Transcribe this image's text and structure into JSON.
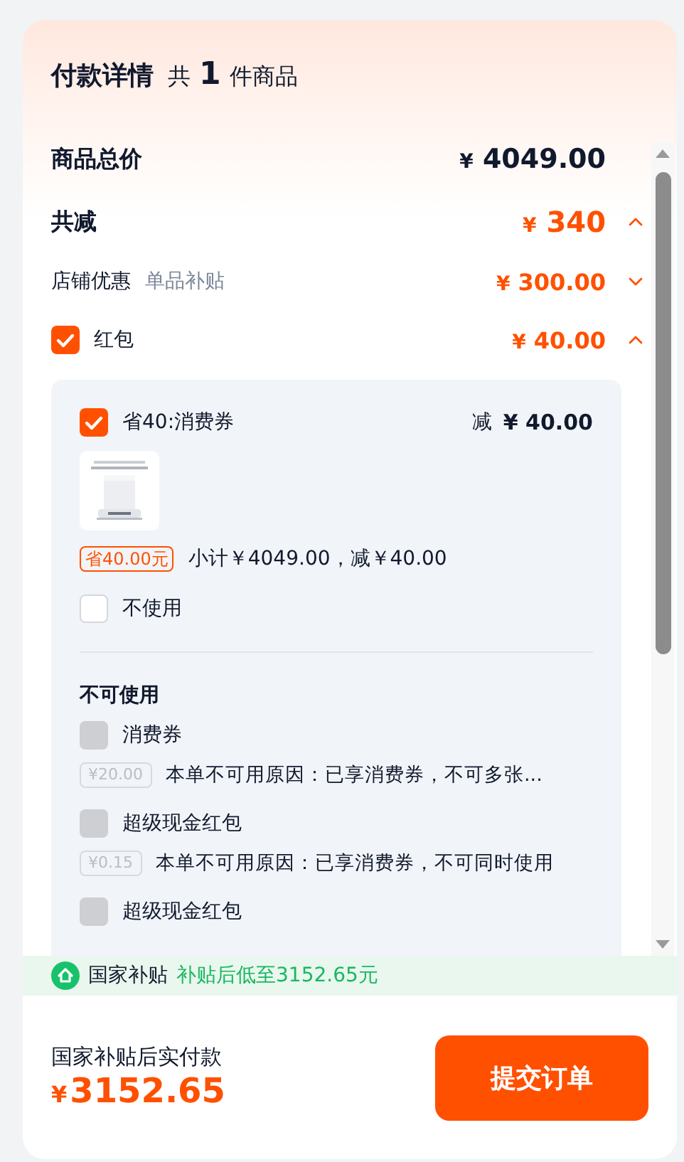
{
  "header": {
    "title": "付款详情",
    "count_prefix": "共",
    "count": "1",
    "count_suffix": "件商品"
  },
  "summary": [
    {
      "kind": "total",
      "label": "商品总价",
      "currency": "¥",
      "amount": "4049.00"
    },
    {
      "kind": "discount_total",
      "label": "共减",
      "currency": "¥",
      "amount": "340",
      "expanded": true
    },
    {
      "kind": "shop",
      "label": "店铺优惠",
      "tag": "单品补贴",
      "currency": "¥",
      "amount": "300.00",
      "expanded": false
    },
    {
      "kind": "check",
      "label": "红包",
      "checked": true,
      "currency": "¥",
      "amount": "40.00",
      "expanded": true
    }
  ],
  "coupons": {
    "available": [
      {
        "name": "省40:消费券",
        "checked": true,
        "deduct_label": "减",
        "currency": "¥",
        "amount": "40.00",
        "badge": "省40.00元",
        "subtotal": "小计￥4049.00，减￥40.00"
      }
    ],
    "none_option": {
      "label": "不使用",
      "checked": false
    },
    "unavailable_title": "不可使用",
    "unavailable": [
      {
        "name": "消费券",
        "disabled": true,
        "value": "¥20.00",
        "reason": "本单不可用原因：已享消费券，不可多张..."
      },
      {
        "name": "超级现金红包",
        "disabled": true,
        "value": "¥0.15",
        "reason": "本单不可用原因：已享消费券，不可同时使用"
      },
      {
        "name": "超级现金红包",
        "disabled": true
      }
    ]
  },
  "subsidy_banner": {
    "label": "国家补贴",
    "text": "补贴后低至3152.65元"
  },
  "footer": {
    "label": "国家补贴后实付款",
    "currency": "¥",
    "amount": "3152.65",
    "submit": "提交订单"
  }
}
